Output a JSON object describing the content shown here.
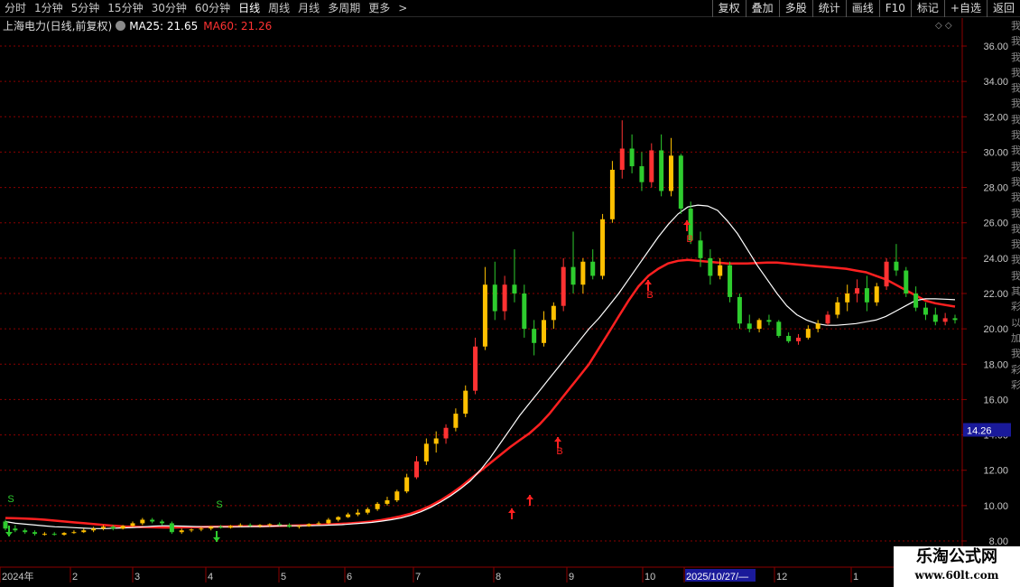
{
  "toolbar": {
    "periods": [
      "分时",
      "1分钟",
      "5分钟",
      "15分钟",
      "30分钟",
      "60分钟",
      "日线",
      "周线",
      "月线",
      "多周期",
      "更多"
    ],
    "active_period": "日线",
    "more_arrow": ">",
    "right_buttons": [
      "复权",
      "叠加",
      "多股",
      "统计",
      "画线",
      "F10",
      "标记",
      "+自选",
      "返回"
    ]
  },
  "info": {
    "symbol": "上海电力(日线,前复权)",
    "ma25_text": "MA25: 21.65",
    "ma60_text": "MA60: 21.26",
    "controls": "◇ ◇"
  },
  "side_strip_chars": [
    "我",
    "我",
    "我",
    "我",
    "我",
    "我",
    "我",
    "我",
    "我",
    "我",
    "我",
    "我",
    "我",
    "我",
    "我",
    "我",
    "我",
    "其",
    "彩",
    "以",
    "加",
    "我",
    "彩",
    "彩"
  ],
  "watermark": {
    "title": "乐淘公式网",
    "url": "www.60lt.com"
  },
  "colors": {
    "up": "#ff3b3b",
    "down": "#00ffff",
    "ma25": "#ffffff",
    "ma60": "#ff2020",
    "grid": "#8b0000",
    "buy": "#ff2020",
    "sell": "#2ecc2e",
    "candle_up_fill": "#ff3232",
    "candle_yellow": "#ffc000",
    "candle_green": "#2ecc2e"
  },
  "chart_data": {
    "type": "candlestick",
    "title": "上海电力(日线,前复权)",
    "y_ticks": [
      "36.00",
      "34.00",
      "32.00",
      "30.00",
      "28.00",
      "26.00",
      "24.00",
      "22.00",
      "20.00",
      "18.00",
      "16.00",
      "14.00",
      "12.00",
      "10.00",
      "8.00"
    ],
    "ylim": [
      8.0,
      37.0
    ],
    "current_price_label": "14.26",
    "x_ticks": [
      "2024年",
      "2",
      "3",
      "4",
      "5",
      "6",
      "7",
      "8",
      "9",
      "10",
      "2025/10/27/—",
      "12",
      "1"
    ],
    "series": [
      {
        "name": "MA25",
        "value": 21.65
      },
      {
        "name": "MA60",
        "value": 21.26
      }
    ],
    "signals": [
      {
        "label": "S",
        "type": "sell",
        "x": "2024年"
      },
      {
        "label": "S",
        "type": "sell",
        "x": "4"
      },
      {
        "label": "B",
        "type": "buy",
        "x": "8"
      },
      {
        "label": "B",
        "type": "buy",
        "x": "9"
      },
      {
        "label": "B",
        "type": "buy",
        "x": "10"
      }
    ],
    "candles": [
      [
        9.1,
        9.2,
        8.6,
        8.7
      ],
      [
        8.7,
        8.9,
        8.5,
        8.6
      ],
      [
        8.6,
        8.7,
        8.4,
        8.5
      ],
      [
        8.5,
        8.6,
        8.3,
        8.4
      ],
      [
        8.4,
        8.5,
        8.3,
        8.4
      ],
      [
        8.4,
        8.5,
        8.3,
        8.35
      ],
      [
        8.35,
        8.5,
        8.3,
        8.45
      ],
      [
        8.45,
        8.6,
        8.4,
        8.5
      ],
      [
        8.5,
        8.7,
        8.45,
        8.6
      ],
      [
        8.6,
        8.8,
        8.5,
        8.7
      ],
      [
        8.7,
        8.9,
        8.6,
        8.8
      ],
      [
        8.8,
        8.9,
        8.6,
        8.7
      ],
      [
        8.7,
        8.9,
        8.65,
        8.85
      ],
      [
        8.85,
        9.1,
        8.8,
        9.0
      ],
      [
        9.0,
        9.3,
        8.9,
        9.2
      ],
      [
        9.2,
        9.3,
        9.0,
        9.1
      ],
      [
        9.1,
        9.2,
        8.9,
        9.0
      ],
      [
        9.0,
        9.1,
        8.4,
        8.5
      ],
      [
        8.5,
        8.7,
        8.4,
        8.6
      ],
      [
        8.6,
        8.7,
        8.5,
        8.65
      ],
      [
        8.65,
        8.8,
        8.55,
        8.7
      ],
      [
        8.7,
        8.85,
        8.6,
        8.8
      ],
      [
        8.8,
        8.9,
        8.7,
        8.75
      ],
      [
        8.75,
        8.9,
        8.7,
        8.85
      ],
      [
        8.85,
        9.0,
        8.8,
        8.9
      ],
      [
        8.9,
        9.0,
        8.8,
        8.85
      ],
      [
        8.85,
        8.95,
        8.75,
        8.9
      ],
      [
        8.9,
        9.0,
        8.8,
        8.95
      ],
      [
        8.95,
        9.05,
        8.85,
        8.9
      ],
      [
        8.9,
        9.0,
        8.75,
        8.8
      ],
      [
        8.8,
        8.9,
        8.7,
        8.85
      ],
      [
        8.85,
        9.0,
        8.8,
        8.95
      ],
      [
        8.95,
        9.1,
        8.9,
        9.0
      ],
      [
        9.0,
        9.3,
        8.95,
        9.2
      ],
      [
        9.2,
        9.4,
        9.1,
        9.35
      ],
      [
        9.35,
        9.6,
        9.3,
        9.5
      ],
      [
        9.5,
        9.8,
        9.4,
        9.6
      ],
      [
        9.6,
        9.9,
        9.5,
        9.8
      ],
      [
        9.8,
        10.2,
        9.7,
        10.1
      ],
      [
        10.1,
        10.5,
        10.0,
        10.3
      ],
      [
        10.3,
        10.9,
        10.2,
        10.8
      ],
      [
        10.8,
        11.8,
        10.7,
        11.6
      ],
      [
        11.6,
        12.8,
        11.5,
        12.5
      ],
      [
        12.5,
        13.8,
        12.3,
        13.5
      ],
      [
        13.5,
        14.2,
        13.0,
        13.8
      ],
      [
        13.8,
        14.6,
        13.5,
        14.4
      ],
      [
        14.4,
        15.5,
        14.2,
        15.2
      ],
      [
        15.2,
        16.8,
        15.0,
        16.5
      ],
      [
        16.5,
        19.5,
        16.3,
        19.0
      ],
      [
        19.0,
        23.5,
        18.8,
        22.5
      ],
      [
        22.5,
        23.8,
        20.5,
        21.0
      ],
      [
        21.0,
        23.0,
        20.5,
        22.5
      ],
      [
        22.5,
        24.5,
        21.5,
        22.0
      ],
      [
        22.0,
        22.5,
        19.5,
        20.0
      ],
      [
        20.0,
        20.5,
        18.5,
        19.2
      ],
      [
        19.2,
        21.0,
        19.0,
        20.5
      ],
      [
        20.5,
        21.5,
        20.0,
        21.3
      ],
      [
        21.3,
        24.0,
        21.0,
        23.5
      ],
      [
        23.5,
        25.5,
        22.0,
        22.5
      ],
      [
        22.5,
        24.0,
        22.0,
        23.8
      ],
      [
        23.8,
        24.5,
        22.8,
        23.0
      ],
      [
        23.0,
        26.5,
        22.8,
        26.2
      ],
      [
        26.2,
        29.5,
        26.0,
        29.0
      ],
      [
        29.0,
        31.8,
        28.5,
        30.2
      ],
      [
        30.2,
        31.0,
        28.8,
        29.2
      ],
      [
        29.2,
        30.0,
        27.8,
        28.3
      ],
      [
        28.3,
        30.5,
        28.0,
        30.1
      ],
      [
        30.1,
        31.0,
        27.5,
        27.8
      ],
      [
        27.8,
        30.8,
        27.5,
        29.8
      ],
      [
        29.8,
        29.9,
        26.5,
        26.8
      ],
      [
        26.8,
        27.2,
        24.8,
        25.0
      ],
      [
        25.0,
        25.5,
        23.5,
        24.0
      ],
      [
        24.0,
        24.5,
        22.5,
        23.0
      ],
      [
        23.0,
        24.0,
        22.8,
        23.6
      ],
      [
        23.6,
        23.8,
        21.5,
        21.8
      ],
      [
        21.8,
        22.0,
        20.0,
        20.3
      ],
      [
        20.3,
        20.8,
        19.8,
        20.0
      ],
      [
        20.0,
        20.6,
        19.8,
        20.5
      ],
      [
        20.5,
        20.8,
        20.2,
        20.4
      ],
      [
        20.4,
        20.5,
        19.5,
        19.6
      ],
      [
        19.6,
        19.8,
        19.2,
        19.3
      ],
      [
        19.3,
        19.7,
        19.1,
        19.5
      ],
      [
        19.5,
        20.2,
        19.4,
        20.0
      ],
      [
        20.0,
        20.5,
        19.8,
        20.3
      ],
      [
        20.3,
        21.0,
        20.2,
        20.8
      ],
      [
        20.8,
        21.8,
        20.6,
        21.5
      ],
      [
        21.5,
        22.5,
        21.0,
        22.0
      ],
      [
        22.0,
        22.8,
        21.5,
        22.3
      ],
      [
        22.3,
        23.0,
        21.0,
        21.5
      ],
      [
        21.5,
        22.6,
        21.3,
        22.4
      ],
      [
        22.4,
        24.0,
        22.2,
        23.8
      ],
      [
        23.8,
        24.8,
        23.0,
        23.3
      ],
      [
        23.3,
        23.5,
        21.8,
        22.0
      ],
      [
        22.0,
        22.4,
        21.0,
        21.2
      ],
      [
        21.2,
        21.5,
        20.5,
        20.8
      ],
      [
        20.8,
        21.2,
        20.2,
        20.4
      ],
      [
        20.4,
        20.9,
        20.2,
        20.6
      ],
      [
        20.6,
        20.8,
        20.3,
        20.5
      ]
    ],
    "ma25_series": [
      9.1,
      9.0,
      8.95,
      8.9,
      8.85,
      8.8,
      8.78,
      8.75,
      8.72,
      8.7,
      8.7,
      8.72,
      8.74,
      8.76,
      8.8,
      8.84,
      8.86,
      8.85,
      8.84,
      8.82,
      8.8,
      8.8,
      8.8,
      8.8,
      8.8,
      8.82,
      8.82,
      8.84,
      8.86,
      8.86,
      8.86,
      8.87,
      8.88,
      8.9,
      8.92,
      8.96,
      9.0,
      9.05,
      9.12,
      9.2,
      9.3,
      9.45,
      9.65,
      9.9,
      10.2,
      10.55,
      10.95,
      11.4,
      12.0,
      12.7,
      13.5,
      14.3,
      15.1,
      15.8,
      16.5,
      17.2,
      17.9,
      18.6,
      19.3,
      20.0,
      20.6,
      21.3,
      22.0,
      22.8,
      23.6,
      24.4,
      25.2,
      25.9,
      26.5,
      26.9,
      27.0,
      26.95,
      26.7,
      26.1,
      25.4,
      24.5,
      23.6,
      22.8,
      22.0,
      21.3,
      20.8,
      20.5,
      20.3,
      20.2,
      20.2,
      20.25,
      20.3,
      20.4,
      20.5,
      20.7,
      21.0,
      21.3,
      21.6,
      21.7,
      21.7,
      21.68,
      21.65
    ],
    "ma60_series": [
      9.3,
      9.28,
      9.26,
      9.24,
      9.2,
      9.15,
      9.1,
      9.05,
      9.0,
      8.95,
      8.9,
      8.86,
      8.82,
      8.8,
      8.78,
      8.77,
      8.76,
      8.76,
      8.77,
      8.78,
      8.79,
      8.8,
      8.81,
      8.82,
      8.83,
      8.84,
      8.84,
      8.85,
      8.86,
      8.87,
      8.88,
      8.9,
      8.92,
      8.94,
      8.97,
      9.0,
      9.05,
      9.1,
      9.18,
      9.28,
      9.4,
      9.55,
      9.75,
      10.0,
      10.3,
      10.65,
      11.05,
      11.5,
      11.95,
      12.4,
      12.85,
      13.3,
      13.7,
      14.1,
      14.6,
      15.2,
      15.9,
      16.6,
      17.3,
      18.0,
      18.9,
      19.8,
      20.7,
      21.6,
      22.4,
      23.0,
      23.4,
      23.7,
      23.85,
      23.9,
      23.85,
      23.8,
      23.75,
      23.7,
      23.7,
      23.7,
      23.72,
      23.75,
      23.75,
      23.7,
      23.65,
      23.6,
      23.55,
      23.5,
      23.45,
      23.4,
      23.3,
      23.2,
      23.0,
      22.8,
      22.5,
      22.2,
      21.9,
      21.6,
      21.45,
      21.35,
      21.26
    ]
  }
}
